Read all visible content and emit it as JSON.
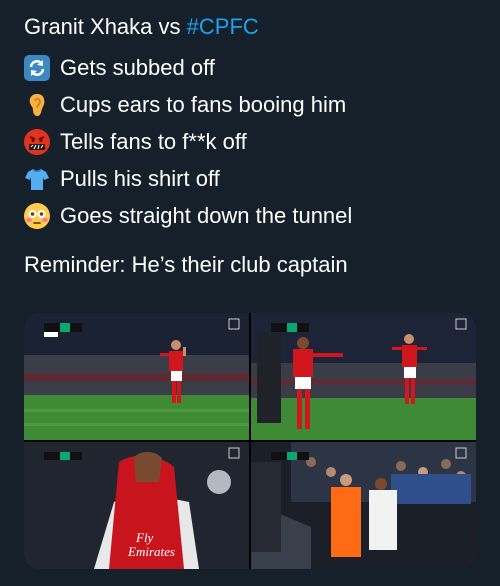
{
  "tweet": {
    "title_prefix": "Granit Xhaka vs ",
    "hashtag": "#CPFC",
    "bullets": [
      {
        "icon": "repeat-arrows-icon",
        "text": "Gets subbed off"
      },
      {
        "icon": "ear-icon",
        "text": "Cups ears to fans booing him"
      },
      {
        "icon": "swearing-face-icon",
        "text": "Tells fans to f**k off"
      },
      {
        "icon": "shirt-icon",
        "text": "Pulls his shirt off"
      },
      {
        "icon": "flushed-face-icon",
        "text": "Goes straight down the tunnel"
      }
    ],
    "reminder": "Reminder: He’s their club captain"
  },
  "media": {
    "frames": [
      {
        "scoreboard_home": "ARS",
        "scoreboard_away": "CRY"
      },
      {
        "scoreboard_home": "ARS",
        "scoreboard_away": "CRY"
      },
      {
        "scoreboard_home": "ARS",
        "scoreboard_away": ""
      },
      {
        "scoreboard_home": "",
        "scoreboard_away": ""
      }
    ],
    "shirt_sponsor": "Fly\nEmirates"
  },
  "colors": {
    "background": "#15202b",
    "text": "#ffffff",
    "hashtag": "#1da1f2",
    "arsenal_red": "#d2161e",
    "pitch_green": "#3f8a34"
  }
}
